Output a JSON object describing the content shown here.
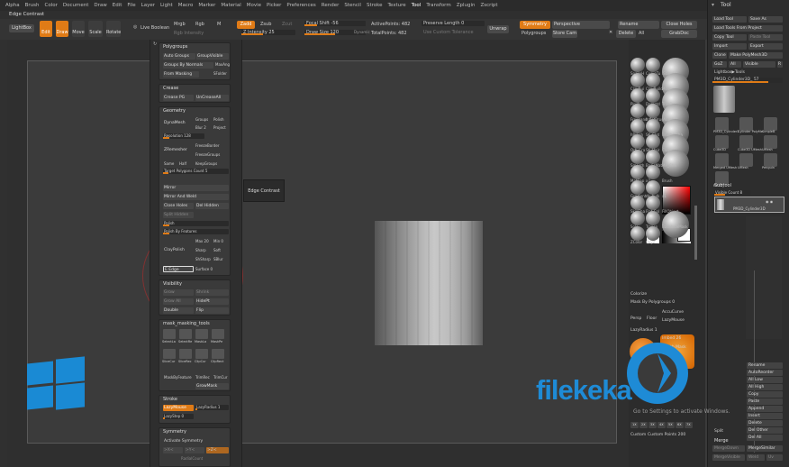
{
  "menubar": [
    "Alpha",
    "Brush",
    "Color",
    "Document",
    "Draw",
    "Edit",
    "File",
    "Layer",
    "Light",
    "Macro",
    "Marker",
    "Material",
    "Movie",
    "Picker",
    "Preferences",
    "Render",
    "Stencil",
    "Stroke",
    "Texture",
    "Tool",
    "Transform",
    "Zplugin",
    "Zscript"
  ],
  "menubar_active": "Tool",
  "window_title": "Edge Contrast",
  "toolbar": {
    "lightbox": "LightBox",
    "edit": "Edit",
    "draw": "Draw",
    "move": "Move",
    "scale": "Scale",
    "rotate": "Rotate",
    "live_boolean": "Live Boolean",
    "mrgb": "Mrgb",
    "rgb": "Rgb",
    "m": "M",
    "zadd": "Zadd",
    "zsub": "Zsub",
    "zcut": "Zcut",
    "rgb_intensity": "Rgb Intensity",
    "z_intensity": "Z Intensity 25",
    "focal_shift": "Focal Shift -56",
    "draw_size": "Draw Size 120",
    "dynamic": "Dynamic",
    "active_points": "ActivePoints: 482",
    "total_points": "TotalPoints: 482",
    "preserve_length": "Preserve Length 0",
    "use_custom_tolerance": "Use Custom Tolerance",
    "unwrap": "Unwrap",
    "symmetry": "Symmetry",
    "polygroups": "Polygroups",
    "perspective": "Perspective",
    "store_cam": "Store Cam",
    "rename": "Rename",
    "delete": "Delete",
    "all": "All",
    "close_holes": "Close Holes",
    "grabdoc": "GrabDoc"
  },
  "popup": {
    "polygroups": {
      "title": "Polygroups",
      "auto_groups": "Auto Groups",
      "group_visible": "GroupVisible",
      "groups_by_normals": "Groups By Normals",
      "maxang": "MaxAng",
      "from_masking": "From Masking",
      "sfolder": "SFolder"
    },
    "crease": {
      "title": "Crease",
      "crease_pg": "Crease PG",
      "uncrease_all": "UnCreaseAll"
    },
    "geometry": {
      "title": "Geometry",
      "dynamesh": "DynaMesh",
      "groups": "Groups",
      "polish": "Polish",
      "blur": "Blur 2",
      "project": "Project",
      "resolution": "Resolution 128",
      "zremesher": "ZRemesher",
      "freeze_border": "FreezeBorder",
      "freeze_groups": "FreezeGroups",
      "same": "Same",
      "half": "Half",
      "keep_groups": "KeepGroups",
      "target_polygons": "Target Polygons Count 5",
      "mirror": "Mirror",
      "mirror_and_weld": "Mirror And Weld",
      "close_holes": "Close Holes",
      "del_hidden": "Del Hidden",
      "split_hidden": "Split Hidden",
      "polish2": "Polish",
      "polish_by_features": "Polish By Features",
      "clay_polish": "ClayPolish",
      "max": "Max 20",
      "min": "Min 0",
      "sharp": "Sharp",
      "soft": "Soft",
      "sharp_v": "ShSharp",
      "blur_v": "SBlur",
      "edge": "E Edge",
      "surface": "Surface 0"
    },
    "visibility": {
      "title": "Visibility",
      "grow": "Grow",
      "shrink": "Shrink",
      "grow_all": "Grow All",
      "hide_pt": "HidePt",
      "double": "Double",
      "flip": "Flip"
    },
    "mask_tools": {
      "title": "mask_masking_tools",
      "tools": [
        "SelectLa",
        "SelectRe",
        "MaskLa",
        "MaskPe",
        "SliceCur",
        "SliceRec",
        "ClipCur",
        "ClipRect"
      ],
      "mask_by_feature": "MaskByFeature",
      "trim_rec": "TrimRec",
      "trim_cur": "TrimCur",
      "grow_mask": "GrowMask"
    },
    "stroke": {
      "title": "Stroke",
      "lazymouse": "LazyMouse",
      "lazyradius": "LazyRadius 1",
      "lazystep": "LazyStep 0"
    },
    "symmetry": {
      "title": "Symmetry",
      "activate": "Activate Symmetry",
      "x": ">X<",
      "y": ">Y<",
      "z": ">Z<",
      "radial": "RadialCount"
    }
  },
  "tooltip": "Edge Contrast",
  "brushes": [
    "SnakeH",
    "CurveTu",
    "IStandar",
    "ClayBui",
    "ClayBuildup",
    "Move",
    "Pinch",
    "Damstd",
    "TrimDyn",
    "Freehand",
    "InflatBrush",
    "JACcut_R",
    "hPolish",
    "SK_Clot",
    "BrushAlpha",
    "Orb_Cra",
    "SK_Hair",
    "Clay",
    "Smooth",
    "BasicMaterial",
    "MP_Cha",
    "MatCap",
    "x7",
    "Brush",
    "Gradient",
    "dk_bulk",
    "x1",
    "SkinSha",
    "Flat Col",
    "FillObject",
    "Solo",
    "Transp",
    "BackfaceMask",
    "ZColor",
    "Qxyz"
  ],
  "colorize": {
    "title": "Colorize",
    "mask_by_polygroups": "Mask By Polygroups 0",
    "accucurve": "AccuCurve",
    "persp": "Persp",
    "floor": "Floor",
    "lazymouse": "LazyMouse",
    "lazyradius": "LazyRadius 1",
    "imbed": "Imbed 26",
    "depth_mask": "Depth Mask",
    "custom": "Custom",
    "custom_points": "Custom Points 200",
    "nums": [
      "1X",
      "2X",
      "3X",
      "4X",
      "5X",
      "6X",
      "7X"
    ]
  },
  "tool_panel": {
    "title": "Tool",
    "load_tool": "Load Tool",
    "save_as": "Save As",
    "load_from_project": "Load Tools From Project",
    "copy_tool": "Copy Tool",
    "paste_tool": "Paste Tool",
    "import": "Import",
    "export": "Export",
    "clone": "Clone",
    "make_polymesh": "Make PolyMesh3D",
    "goz": "GoZ",
    "all": "All",
    "visible": "Visible",
    "r": "R",
    "lightbox_tools": "Lightbox▶Tools",
    "current_tool": "PM3D_Cylinder3D_ 57",
    "tool_thumbs": [
      "PM3D_Cylinder3",
      "Cylinder PolyMe",
      "SimpleB",
      "Cube3D",
      "Cube3D UMesh",
      "UMesh",
      "Merged UMesh",
      "UMesh",
      "Penguin",
      "PM3D_"
    ],
    "subtool": "Subtool",
    "visible_count": "Visible Count 8",
    "subtool_item": "PM3D_Cylinder3D",
    "split": "Split",
    "merge": "Merge",
    "merge_down": "MergeDown",
    "merge_similar": "MergeSimilar",
    "merge_visible": "MergeVisible",
    "weld": "Weld",
    "uv": "Uv",
    "actions": [
      "Rename",
      "AutoReorder",
      "All Low",
      "All High",
      "Copy",
      "Paste",
      "Append",
      "Insert",
      "Delete",
      "Del Other",
      "Del All"
    ]
  },
  "watermark": {
    "text": "filekeka",
    "activate": "Go to Settings to activate Windows."
  }
}
